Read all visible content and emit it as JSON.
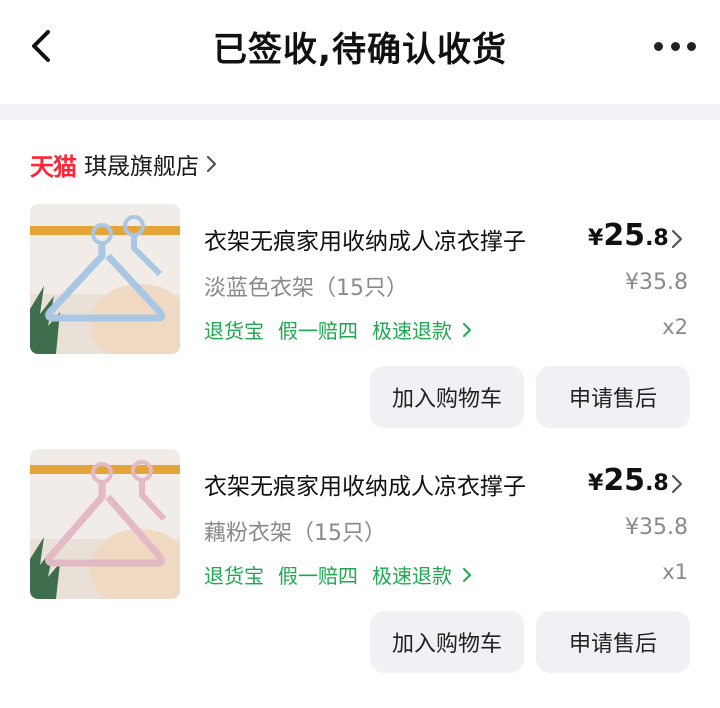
{
  "header": {
    "title": "已签收,待确认收货"
  },
  "shop": {
    "platform": "天猫",
    "name": "琪晟旗舰店"
  },
  "items": [
    {
      "name": "衣架无痕家用收纳成人凉衣撑子",
      "price_currency": "¥",
      "price_int": "25",
      "price_dec": ".8",
      "spec": "淡蓝色衣架（15只）",
      "original_price": "¥35.8",
      "tags": [
        "退货宝",
        "假一赔四",
        "极速退款"
      ],
      "quantity": "x2",
      "color": "#a9c6e2",
      "buttons": {
        "cart": "加入购物车",
        "after_sale": "申请售后"
      }
    },
    {
      "name": "衣架无痕家用收纳成人凉衣撑子",
      "price_currency": "¥",
      "price_int": "25",
      "price_dec": ".8",
      "spec": "藕粉衣架（15只）",
      "original_price": "¥35.8",
      "tags": [
        "退货宝",
        "假一赔四",
        "极速退款"
      ],
      "quantity": "x1",
      "color": "#e2b9c4",
      "buttons": {
        "cart": "加入购物车",
        "after_sale": "申请售后"
      }
    }
  ],
  "colors": {
    "tmall_red": "#ff2433",
    "tag_green": "#1fa84f",
    "muted_gray": "#8a8a8a",
    "button_bg": "#f0f1f4"
  }
}
